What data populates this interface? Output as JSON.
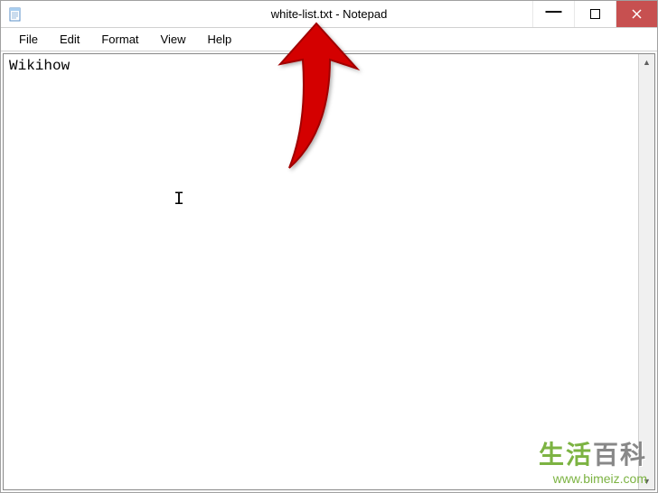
{
  "window": {
    "title": "white-list.txt - Notepad"
  },
  "menu": {
    "file": "File",
    "edit": "Edit",
    "format": "Format",
    "view": "View",
    "help": "Help"
  },
  "content": {
    "text": "Wikihow"
  },
  "watermark": {
    "title_cn_1": "生活",
    "title_cn_2": "百科",
    "url": "www.bimeiz.com"
  }
}
